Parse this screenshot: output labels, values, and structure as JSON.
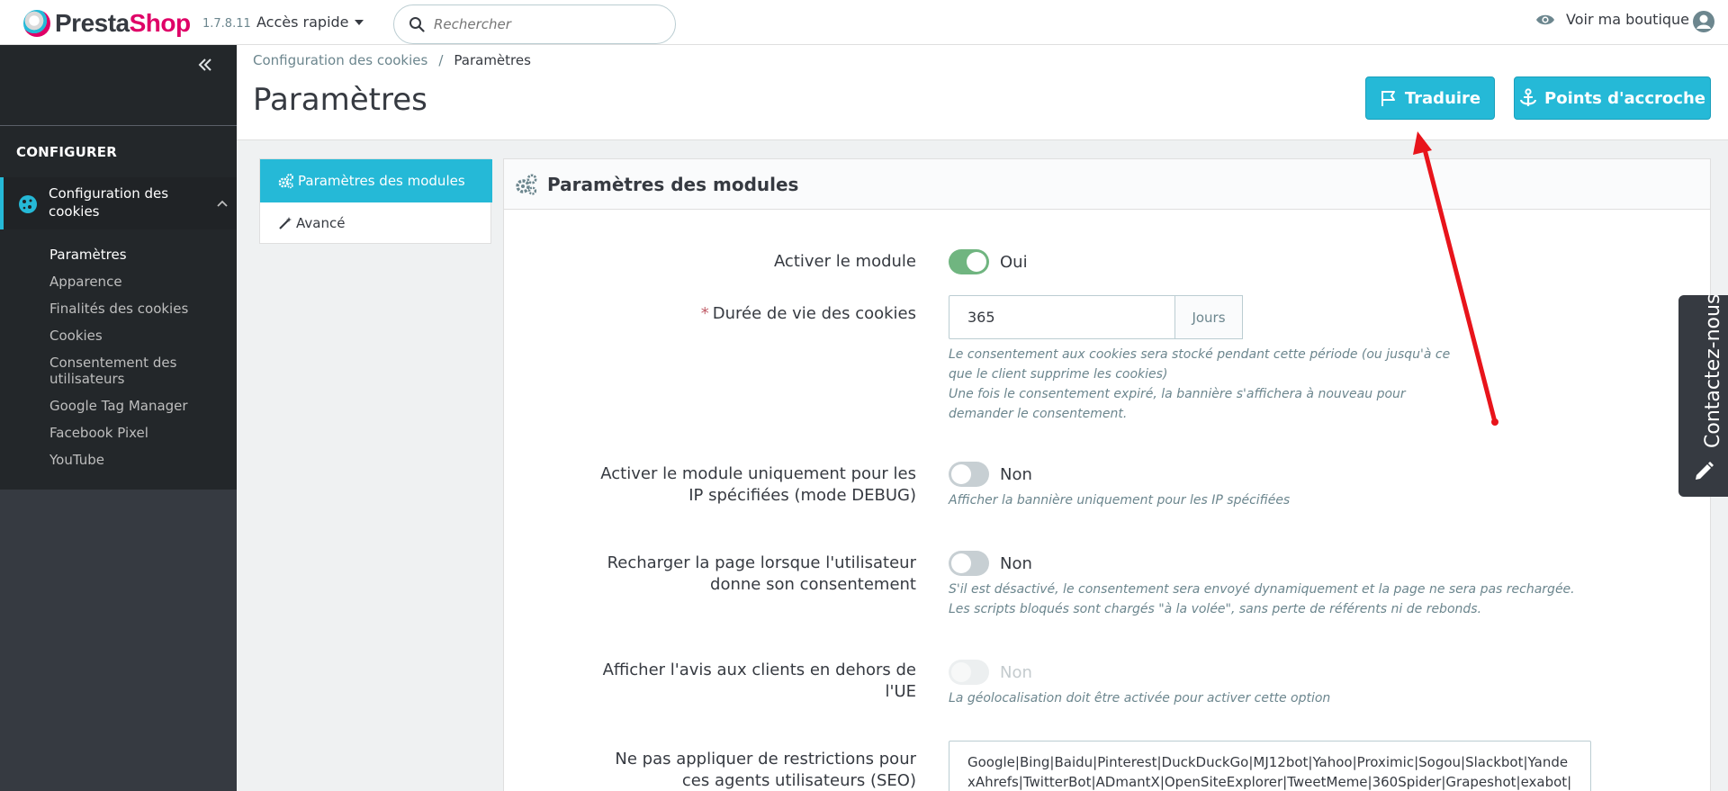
{
  "header": {
    "logo_part1": "Presta",
    "logo_part2": "Shop",
    "version": "1.7.8.11",
    "quick_access_label": "Accès rapide",
    "search_placeholder": "Rechercher",
    "view_shop_label": "Voir ma boutique"
  },
  "sidebar": {
    "section_title": "CONFIGURER",
    "active_item_label": "Configuration des cookies",
    "sub_items": [
      "Paramètres",
      "Apparence",
      "Finalités des cookies",
      "Cookies",
      "Consentement des utilisateurs",
      "Google Tag Manager",
      "Facebook Pixel",
      "YouTube"
    ],
    "current_sub_item_index": 0
  },
  "page": {
    "breadcrumb_parent": "Configuration des cookies",
    "breadcrumb_separator": "/",
    "breadcrumb_current": "Paramètres",
    "title": "Paramètres",
    "translate_button": "Traduire",
    "hooks_button": "Points d'accroche"
  },
  "tabs": {
    "active": "Paramètres des modules",
    "other": "Avancé"
  },
  "card": {
    "title": "Paramètres des modules",
    "fields": {
      "enable_module": {
        "label": "Activer le module",
        "value": "Oui",
        "state": "on"
      },
      "cookie_lifetime": {
        "required_mark": "*",
        "label": "Durée de vie des cookies",
        "value": "365",
        "addon": "Jours",
        "help_line1": "Le consentement aux cookies sera stocké pendant cette période (ou jusqu'à ce",
        "help_line2": "que le client supprime les cookies)",
        "help_line3": "Une fois le consentement expiré, la bannière s'affichera à nouveau pour",
        "help_line4": "demander le consentement."
      },
      "debug_ips": {
        "label_line1": "Activer le module uniquement pour les",
        "label_line2": "IP spécifiées (mode DEBUG)",
        "value": "Non",
        "state": "off",
        "help": "Afficher la bannière uniquement pour les IP spécifiées"
      },
      "reload_page": {
        "label_line1": "Recharger la page lorsque l'utilisateur",
        "label_line2": "donne son consentement",
        "value": "Non",
        "state": "off",
        "help_line1": "S'il est désactivé, le consentement sera envoyé dynamiquement et la page ne sera pas rechargée.",
        "help_line2": "Les scripts bloqués sont chargés \"à la volée\", sans perte de référents ni de rebonds."
      },
      "outside_eu": {
        "label_line1": "Afficher l'avis aux clients en dehors de",
        "label_line2": "l'UE",
        "value": "Non",
        "state": "disabled",
        "help": "La géolocalisation doit être activée pour activer cette option"
      },
      "seo_agents": {
        "label_line1": "Ne pas appliquer de restrictions pour",
        "label_line2": "ces agents utilisateurs (SEO)",
        "value_line1": "Google|Bing|Baidu|Pinterest|DuckDuckGo|MJ12bot|Yahoo|Proximic|Sogou|Slackbot|Yande",
        "value_line2": "xAhrefs|TwitterBot|ADmantX|OpenSiteExplorer|TweetMeme|360Spider|Grapeshot|exabot|"
      }
    }
  },
  "contact_tab_label": "Contactez-nous",
  "colors": {
    "accent": "#25b9d7",
    "brand_pink": "#df0067",
    "sidebar_dark": "#23272a",
    "switch_on": "#70b580",
    "annotation_arrow": "#e8141b"
  }
}
